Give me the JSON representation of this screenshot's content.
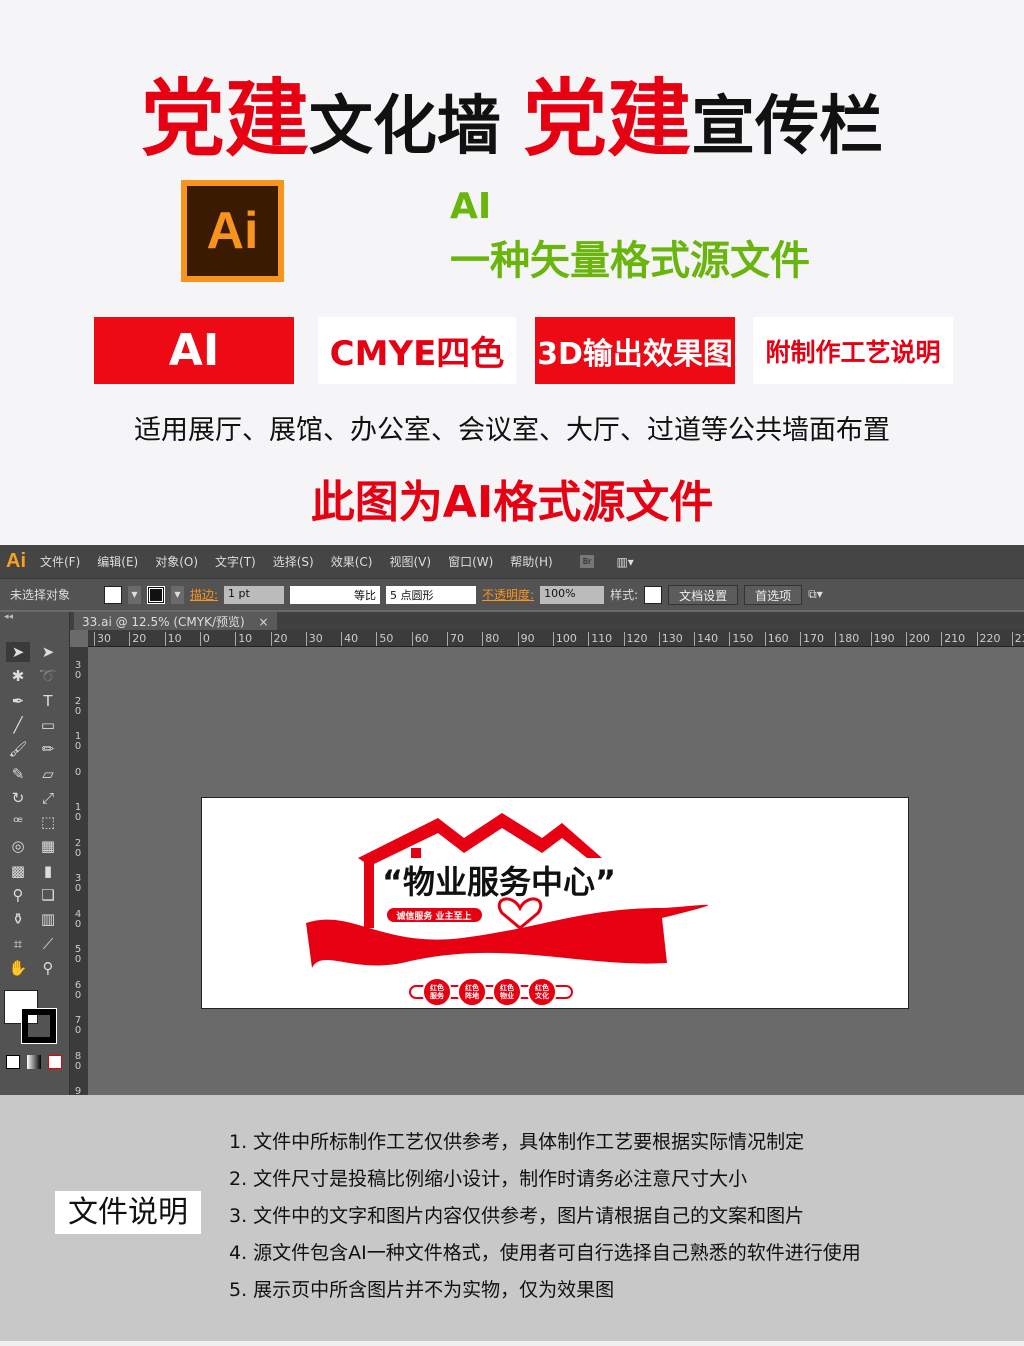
{
  "header": {
    "title_parts": [
      {
        "text": "党建",
        "style": "red"
      },
      {
        "text": "文化墙  ",
        "style": "black"
      },
      {
        "text": "党建",
        "style": "red"
      },
      {
        "text": "宣传栏",
        "style": "black"
      }
    ],
    "logo_text": "Ai",
    "format_label": "AI",
    "format_desc": "一种矢量格式源文件"
  },
  "tags": [
    {
      "label": "AI",
      "style": "red"
    },
    {
      "label": "CMYE四色",
      "style": "white"
    },
    {
      "label": "3D输出效果图",
      "style": "red"
    },
    {
      "label": "附制作工艺说明",
      "style": "white"
    }
  ],
  "usage": "适用展厅、展馆、办公室、会议室、大厅、过道等公共墙面布置",
  "source_note": "此图为AI格式源文件",
  "illustrator": {
    "logo": "Ai",
    "menu": [
      "文件(F)",
      "编辑(E)",
      "对象(O)",
      "文字(T)",
      "选择(S)",
      "效果(C)",
      "视图(V)",
      "窗口(W)",
      "帮助(H)"
    ],
    "bridge": "Br",
    "control": {
      "selection": "未选择对象",
      "stroke_label": "描边:",
      "stroke_value": "1 pt",
      "stroke_style": "等比",
      "brush": "5 点圆形",
      "opacity_label": "不透明度:",
      "opacity_value": "100%",
      "style_label": "样式:",
      "doc_setup": "文档设置",
      "prefs": "首选项"
    },
    "doc_tab": "33.ai @ 12.5% (CMYK/预览)",
    "close": "×",
    "hruler": [
      "30",
      "20",
      "10",
      "0",
      "10",
      "20",
      "30",
      "40",
      "50",
      "60",
      "70",
      "80",
      "90",
      "100",
      "110",
      "120",
      "130",
      "140",
      "150",
      "160",
      "170",
      "180",
      "190",
      "200",
      "210",
      "220",
      "23"
    ],
    "vruler": [
      "3 0",
      "2 0",
      "1 0",
      "0",
      "1 0",
      "2 0",
      "3 0",
      "4 0",
      "5 0",
      "6 0",
      "7 0",
      "8 0",
      "9"
    ],
    "tools": [
      "selection-arrow",
      "direct-selection",
      "magic-wand",
      "lasso",
      "pen",
      "type",
      "line",
      "rectangle",
      "paintbrush",
      "pencil",
      "blob-brush",
      "eraser",
      "rotate",
      "scale",
      "warp",
      "free-transform",
      "shape-builder",
      "perspective-grid",
      "mesh",
      "gradient",
      "eyedropper",
      "blend",
      "symbol-sprayer",
      "column-graph",
      "artboard",
      "slice",
      "hand",
      "zoom"
    ],
    "artwork": {
      "title": "“物业服务中心”",
      "slogan": "诚信服务 业主至上",
      "badges": [
        "红色服务",
        "红色阵地",
        "红色物业",
        "红色文化"
      ],
      "color": "#e60012"
    }
  },
  "notes": {
    "label": "文件说明",
    "items": [
      "1. 文件中所标制作工艺仅供参考，具体制作工艺要根据实际情况制定",
      "2. 文件尺寸是投稿比例缩小设计，制作时请务必注意尺寸大小",
      "3. 文件中的文字和图片内容仅供参考，图片请根据自己的文案和图片",
      "4. 源文件包含AI一种文件格式，使用者可自行选择自己熟悉的软件进行使用",
      "5. 展示页中所含图片并不为实物，仅为效果图"
    ]
  },
  "colors": {
    "red": "#e60012",
    "green": "#6ab50c",
    "ai_orange": "#f7941d"
  }
}
